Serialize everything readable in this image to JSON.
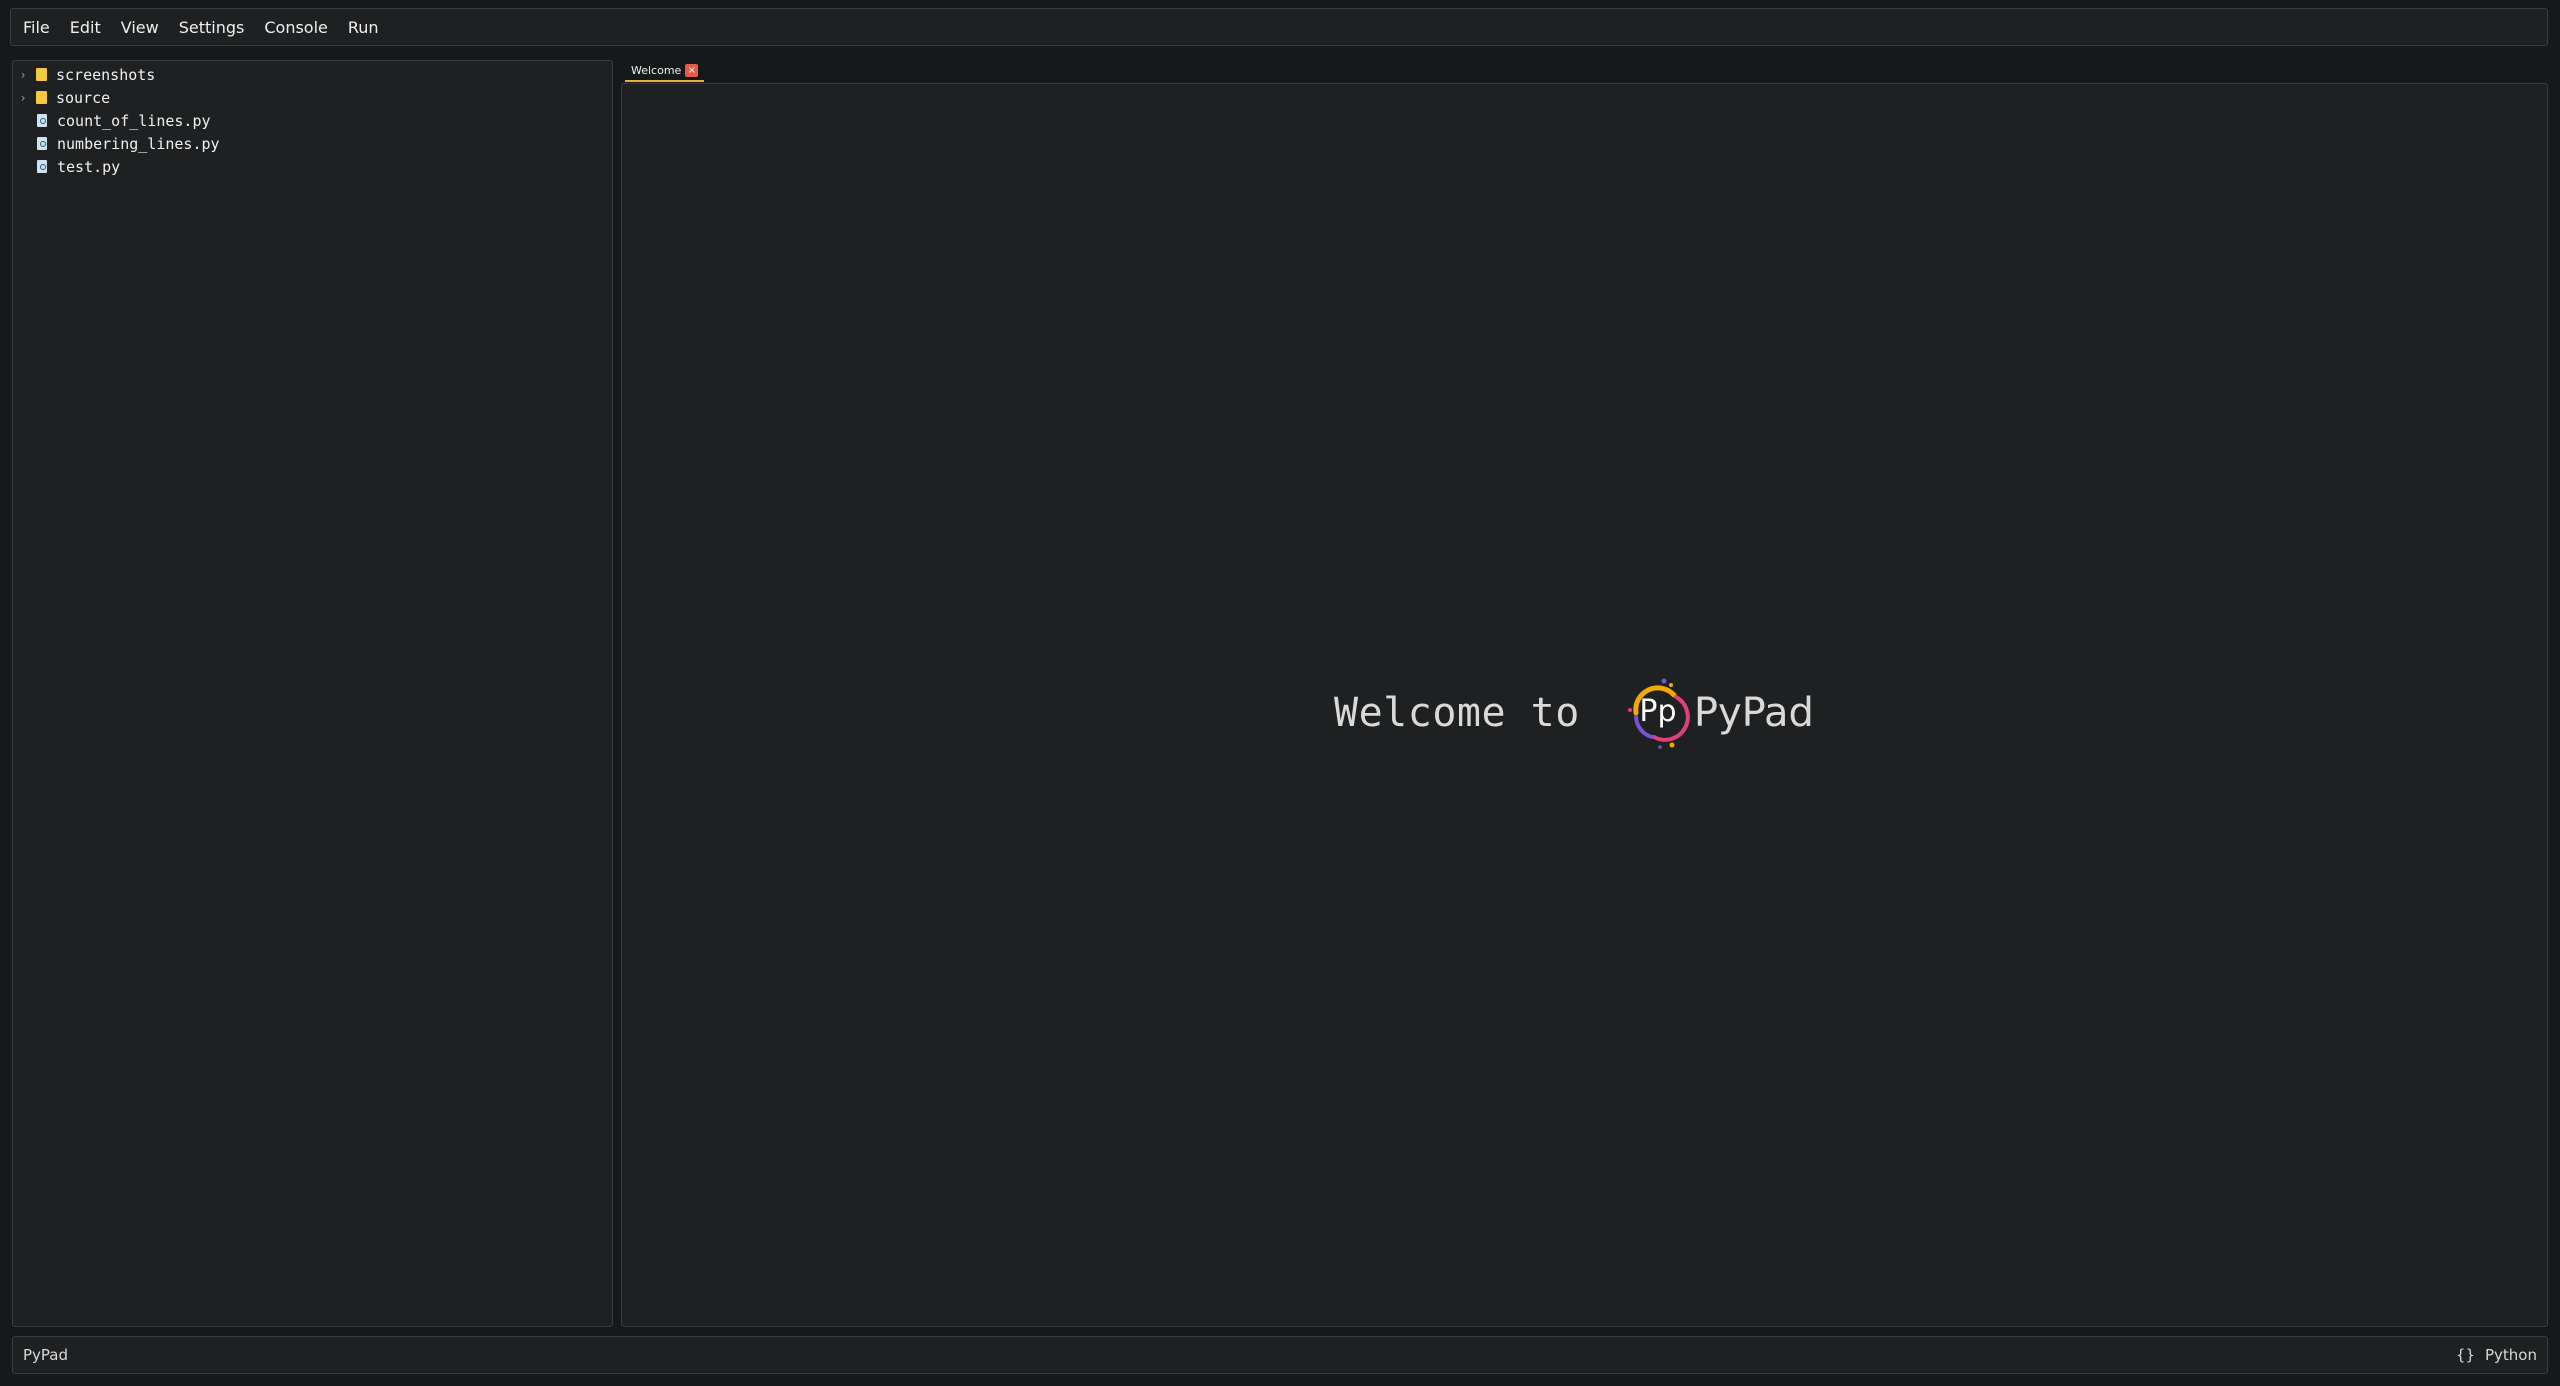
{
  "menubar": {
    "items": [
      "File",
      "Edit",
      "View",
      "Settings",
      "Console",
      "Run"
    ]
  },
  "explorer": {
    "folders": [
      "screenshots",
      "source"
    ],
    "files": [
      "count_of_lines.py",
      "numbering_lines.py",
      "test.py"
    ]
  },
  "tabs": [
    {
      "label": "Welcome",
      "close": "×"
    }
  ],
  "welcome": {
    "prefix": "Welcome to",
    "logo_text": "Pp",
    "app_name": "PyPad"
  },
  "statusbar": {
    "left": "PyPad",
    "lang_icon": "{}",
    "language": "Python"
  },
  "colors": {
    "accent": "#e8b23a",
    "tab_close": "#e55a4a",
    "folder": "#f5c842",
    "background": "#1e2021"
  }
}
